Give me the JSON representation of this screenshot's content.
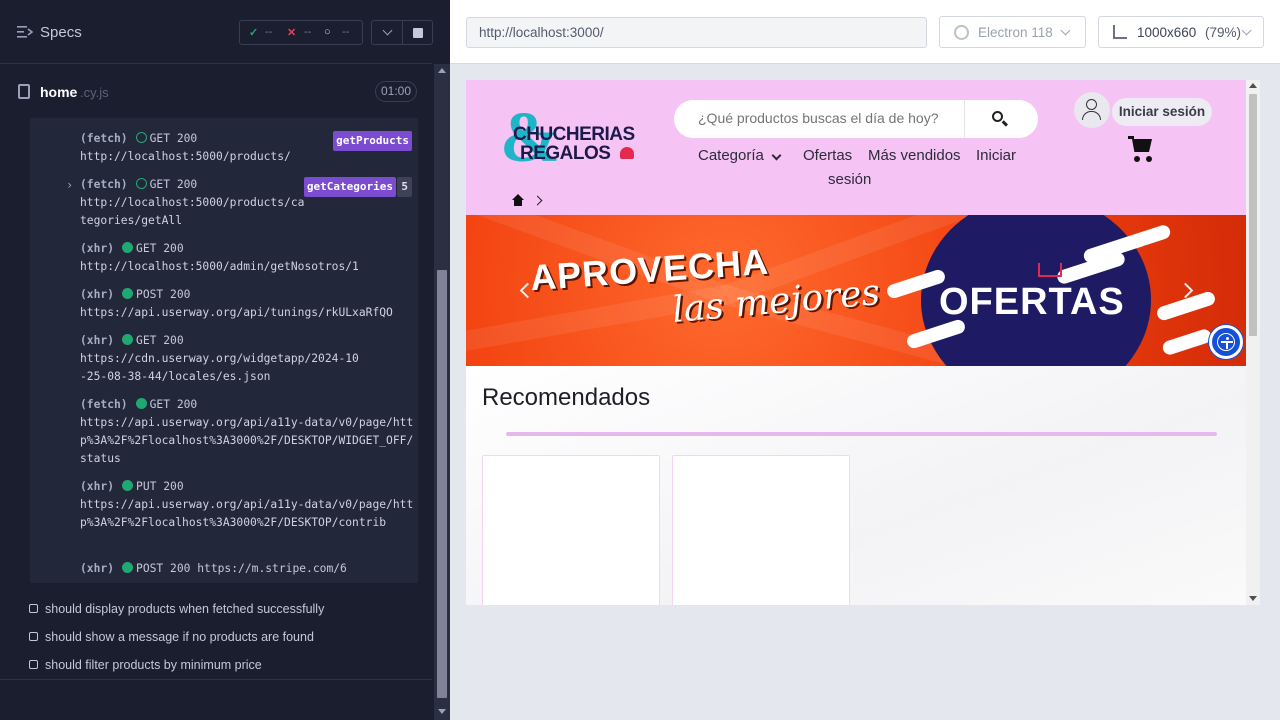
{
  "runner": {
    "specs_title": "Specs",
    "stats": {
      "passed": "--",
      "failed": "--",
      "pending": "--"
    },
    "file": {
      "name": "home",
      "ext": ".cy.js",
      "duration": "01:00"
    },
    "log": [
      {
        "type": "(fetch)",
        "method": "GET 200",
        "url": "http://localhost:5000/products/",
        "alias": "getProducts",
        "dot": "hollow"
      },
      {
        "type": "(fetch)",
        "method": "GET 200",
        "url": "http://localhost:5000/products/categories/getAll",
        "alias": "getCategories",
        "count": "5",
        "dot": "hollow"
      },
      {
        "type": "(xhr)",
        "method": "GET 200",
        "url": "http://localhost:5000/admin/getNosotros/1",
        "dot": "filled"
      },
      {
        "type": "(xhr)",
        "method": "POST 200",
        "url": "https://api.userway.org/api/tunings/rkULxaRfQO",
        "dot": "filled"
      },
      {
        "type": "(xhr)",
        "method": "GET 200",
        "url": "https://cdn.userway.org/widgetapp/2024-10-25-08-38-44/locales/es.json",
        "dot": "filled"
      },
      {
        "type": "(fetch)",
        "method": "GET 200",
        "url": "https://api.userway.org/api/a11y-data/v0/page/http%3A%2F%2Flocalhost%3A3000%2F/DESKTOP/WIDGET_OFF/status",
        "dot": "filled"
      },
      {
        "type": "(xhr)",
        "method": "PUT 200",
        "url": "https://api.userway.org/api/a11y-data/v0/page/http%3A%2F%2Flocalhost%3A3000%2F/DESKTOP/contrib",
        "dot": "filled"
      },
      {
        "type": "(xhr)",
        "method": "POST 200 https://m.stripe.com/6",
        "url": "",
        "dot": "filled"
      }
    ],
    "tests": [
      "should display products when fetched successfully",
      "should show a message if no products are found",
      "should filter products by minimum price"
    ]
  },
  "browser_bar": {
    "url": "http://localhost:3000/",
    "browser": "Electron 118",
    "viewport": "1000x660",
    "zoom": "(79%)"
  },
  "site": {
    "logo_line1": "CHUCHERIAS",
    "logo_line2": "REGALOS",
    "search_placeholder": "¿Qué productos buscas el día de hoy?",
    "login": "Iniciar sesión",
    "nav": {
      "category": "Categoría",
      "offers": "Ofertas",
      "bestsellers": "Más vendidos",
      "login_1": "Iniciar",
      "login_2": "sesión"
    },
    "banner": {
      "line1": "APROVECHA",
      "line2": "las mejores",
      "line3": "OFERTAS"
    },
    "recommended_title": "Recomendados"
  },
  "colors": {
    "runner_bg": "#1b1e2e",
    "header_pink": "#f6c4f4",
    "banner_orange": "#f2400f",
    "alias_purple": "#7b4bd0",
    "status_green": "#1fa971"
  }
}
